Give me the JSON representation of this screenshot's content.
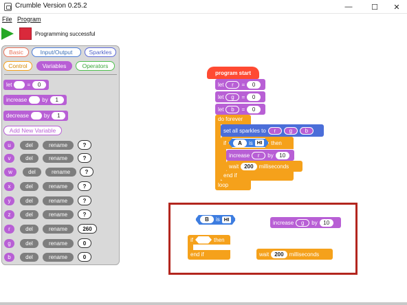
{
  "window": {
    "title": "Crumble Version 0.25.2",
    "controls": {
      "minimize": "—",
      "maximize": "☐",
      "close": "✕"
    }
  },
  "menu": {
    "file": "File",
    "program": "Program"
  },
  "toolbar": {
    "status": "Programming successful"
  },
  "palette": {
    "tabs": {
      "basic": "Basic",
      "input_output": "Input/Output",
      "sparkles": "Sparkles",
      "control": "Control",
      "variables": "Variables",
      "operators": "Operators"
    },
    "blocks": {
      "let": {
        "label": "let",
        "eq": "=",
        "value": "0"
      },
      "increase": {
        "label": "increase",
        "by": "by",
        "value": "1"
      },
      "decrease": {
        "label": "decrease",
        "by": "by",
        "value": "1"
      },
      "add_var": "Add New Variable"
    },
    "variables": [
      {
        "name": "u",
        "del": "del",
        "rename": "rename",
        "value": "?"
      },
      {
        "name": "v",
        "del": "del",
        "rename": "rename",
        "value": "?"
      },
      {
        "name": "w",
        "del": "del",
        "rename": "rename",
        "value": "?"
      },
      {
        "name": "x",
        "del": "del",
        "rename": "rename",
        "value": "?"
      },
      {
        "name": "y",
        "del": "del",
        "rename": "rename",
        "value": "?"
      },
      {
        "name": "z",
        "del": "del",
        "rename": "rename",
        "value": "?"
      },
      {
        "name": "r",
        "del": "del",
        "rename": "rename",
        "value": "260"
      },
      {
        "name": "g",
        "del": "del",
        "rename": "rename",
        "value": "0"
      },
      {
        "name": "b",
        "del": "del",
        "rename": "rename",
        "value": "0"
      }
    ]
  },
  "program": {
    "start": "program start",
    "let_r": {
      "kw": "let",
      "var": "r",
      "eq": "=",
      "value": "0"
    },
    "let_g": {
      "kw": "let",
      "var": "g",
      "eq": "=",
      "value": "0"
    },
    "let_b": {
      "kw": "let",
      "var": "b",
      "eq": "=",
      "value": "0"
    },
    "do_forever": "do forever",
    "set_sparkles": {
      "label": "set all sparkles to",
      "r": "r",
      "g": "g",
      "b": "b"
    },
    "if_block": {
      "kw": "if",
      "cond_var": "A",
      "is": "is",
      "state": "HI",
      "then": "then"
    },
    "increase_r": {
      "label": "increase",
      "var": "r",
      "by": "by",
      "value": "10"
    },
    "wait": {
      "label": "wait",
      "value": "200",
      "unit": "milliseconds"
    },
    "end_if": "end if",
    "loop": "loop"
  },
  "loose": {
    "cond": {
      "var": "B",
      "is": "is",
      "state": "HI"
    },
    "increase_g": {
      "label": "increase",
      "var": "g",
      "by": "by",
      "value": "10"
    },
    "if": {
      "kw": "if",
      "then": "then",
      "end": "end if"
    },
    "wait": {
      "label": "wait",
      "value": "200",
      "unit": "milliseconds"
    }
  }
}
